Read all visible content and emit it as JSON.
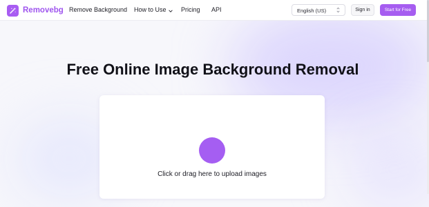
{
  "brand": {
    "name": "Removebg",
    "logo_icon": "magic-wand-icon",
    "accent_color": "#a65df0"
  },
  "nav": {
    "items": [
      {
        "label": "Remove Background"
      },
      {
        "label": "How to Use",
        "icon": "chevron-down-icon"
      },
      {
        "label": "Pricing"
      },
      {
        "label": "API"
      }
    ]
  },
  "language_select": {
    "value": "English (US)",
    "icon": "chevron-updown-icon"
  },
  "auth": {
    "signin_label": "Sign in",
    "start_label": "Start for Free"
  },
  "hero": {
    "title": "Free Online Image Background Removal"
  },
  "upload": {
    "prompt": "Click or drag here to upload images",
    "button_color": "#a55ef2"
  }
}
